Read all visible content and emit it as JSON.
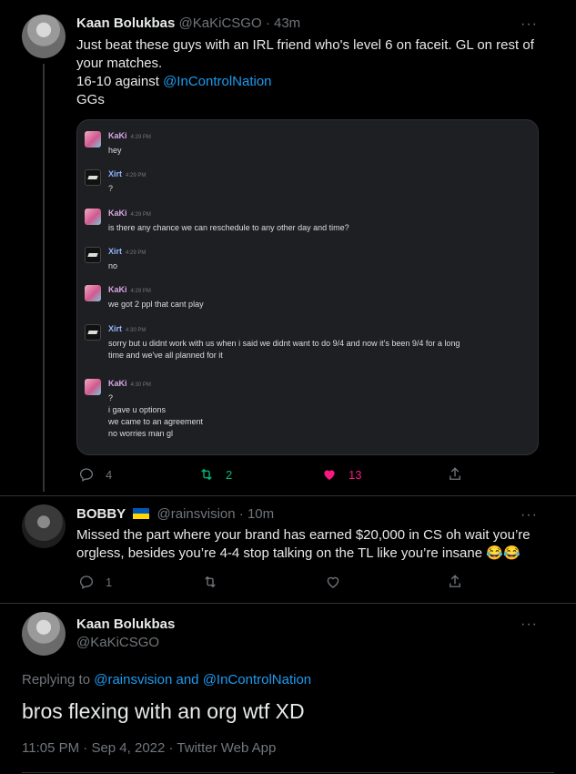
{
  "tweet1": {
    "name": "Kaan Bolukbas",
    "handle": "@KaKiCSGO",
    "sep": "·",
    "time": "43m",
    "text_line1": "Just beat these guys with an IRL friend who's level 6 on faceit. GL on rest of",
    "text_line2": "your matches.",
    "text_line3_prefix": "16-10 against ",
    "text_line3_mention": "@InControlNation",
    "text_line4": "GGs",
    "more": "···",
    "replies": "4",
    "retweets": "2",
    "likes": "13"
  },
  "embed": {
    "messages": [
      {
        "author": "KaKi",
        "time": "4:29 PM",
        "lines": [
          "hey"
        ]
      },
      {
        "author": "Xirt",
        "time": "4:29 PM",
        "lines": [
          "?"
        ]
      },
      {
        "author": "KaKi",
        "time": "4:29 PM",
        "lines": [
          "is there any chance we can reschedule to any other day and time?"
        ]
      },
      {
        "author": "Xirt",
        "time": "4:29 PM",
        "lines": [
          "no"
        ]
      },
      {
        "author": "KaKi",
        "time": "4:29 PM",
        "lines": [
          "we got 2 ppl that cant play"
        ]
      },
      {
        "author": "Xirt",
        "time": "4:30 PM",
        "lines": [
          "sorry but u didnt work with us when i said we didnt want to do 9/4 and now it's been 9/4 for a long",
          "time and we've all planned for it"
        ]
      },
      {
        "author": "KaKi",
        "time": "4:30 PM",
        "lines": [
          "?",
          "i gave u options",
          "we came to an agreement",
          "no worries man gl"
        ]
      }
    ]
  },
  "tweet2": {
    "name": "BOBBY",
    "handle": "@rainsvision",
    "sep": "·",
    "time": "10m",
    "text_line1": "Missed the part where your brand has earned $20,000 in CS oh wait you’re",
    "text_line2": "orgless, besides you’re 4-4 stop talking on the TL like you’re insane",
    "emoji": "😂😂",
    "more": "···",
    "replies": "1"
  },
  "tweet3": {
    "name": "Kaan Bolukbas",
    "handle": "@KaKiCSGO",
    "more": "···",
    "replying_prefix": "Replying to ",
    "replying_user1": "@rainsvision",
    "replying_and": " and ",
    "replying_user2": "@InControlNation",
    "text": "bros flexing with an org wtf XD",
    "meta_time": "11:05 PM",
    "meta_sep1": " · ",
    "meta_date": "Sep 4, 2022",
    "meta_sep2": " · ",
    "meta_source": "Twitter Web App"
  },
  "colors": {
    "background": "#000000",
    "text": "#e7e9ea",
    "muted": "#71767b",
    "link": "#1d9bf0",
    "retweet": "#00ba7c",
    "like": "#f91880"
  }
}
